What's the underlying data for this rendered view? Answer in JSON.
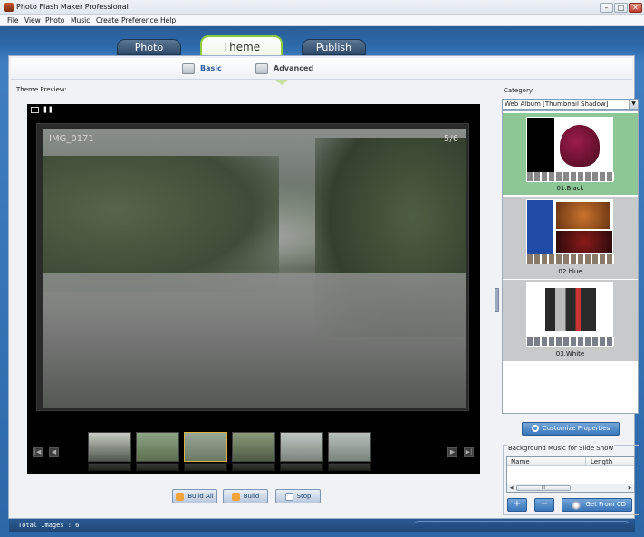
{
  "window": {
    "title": "Photo Flash Maker Professional",
    "min": "–",
    "max": "□",
    "close": "✕"
  },
  "menu": [
    "File",
    "View",
    "Photo",
    "Music",
    "Create",
    "Preference",
    "Help"
  ],
  "main_tabs": [
    {
      "label": "Photo",
      "active": false
    },
    {
      "label": "Theme",
      "active": true
    },
    {
      "label": "Publish",
      "active": false
    }
  ],
  "sub_tabs": [
    {
      "label": "Basic",
      "icon": "basic-settings-icon"
    },
    {
      "label": "Advanced",
      "icon": "advanced-settings-icon",
      "active": true
    }
  ],
  "preview": {
    "label": "Theme Preview:",
    "image_name": "IMG_0171",
    "image_counter": "5/6",
    "controls": {
      "fullscreen": "fullscreen-icon",
      "pause": "❚❚"
    },
    "nav_left": [
      "|◀",
      "◀"
    ],
    "nav_right": [
      "▶",
      "▶|"
    ],
    "thumbnail_count": 6,
    "selected_thumbnail": 3
  },
  "build_buttons": [
    {
      "label": "Build All",
      "icon": "build-all-icon"
    },
    {
      "label": "Build",
      "icon": "build-icon"
    },
    {
      "label": "Stop",
      "icon": "stop-icon"
    }
  ],
  "category": {
    "label": "Category:",
    "selected": "Web Album [Thumbnail Shadow]",
    "dropdown": "▼"
  },
  "themes": [
    {
      "label": "01.Black",
      "selected": true
    },
    {
      "label": "02.blue",
      "selected": false
    },
    {
      "label": "03.White",
      "selected": false
    }
  ],
  "customize_button": "Customize Properties",
  "background_music": {
    "title": "Background Music for Slide Show",
    "columns": [
      "Name",
      "Length"
    ],
    "scroll_left": "◀",
    "scroll_right": "▶",
    "scroll_grip": "III",
    "add_label": "+",
    "remove_label": "−",
    "get_cd_label": "Get From CD"
  },
  "status": {
    "text": "Total Images : 6"
  },
  "colors": {
    "accent_green": "#8ccc3e",
    "chrome_blue": "#2c68a8",
    "selected_theme": "#8dc795"
  }
}
